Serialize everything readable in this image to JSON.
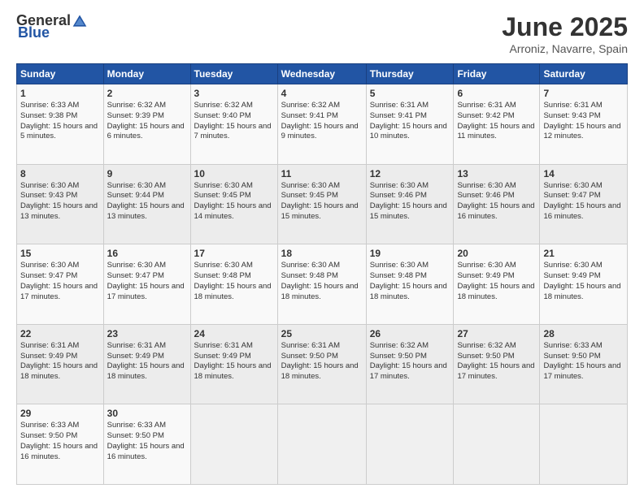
{
  "header": {
    "logo_general": "General",
    "logo_blue": "Blue",
    "month_title": "June 2025",
    "location": "Arroniz, Navarre, Spain"
  },
  "calendar": {
    "days_of_week": [
      "Sunday",
      "Monday",
      "Tuesday",
      "Wednesday",
      "Thursday",
      "Friday",
      "Saturday"
    ],
    "weeks": [
      [
        {
          "day": "1",
          "sunrise": "6:33 AM",
          "sunset": "9:38 PM",
          "daylight": "15 hours and 5 minutes."
        },
        {
          "day": "2",
          "sunrise": "6:32 AM",
          "sunset": "9:39 PM",
          "daylight": "15 hours and 6 minutes."
        },
        {
          "day": "3",
          "sunrise": "6:32 AM",
          "sunset": "9:40 PM",
          "daylight": "15 hours and 7 minutes."
        },
        {
          "day": "4",
          "sunrise": "6:32 AM",
          "sunset": "9:41 PM",
          "daylight": "15 hours and 9 minutes."
        },
        {
          "day": "5",
          "sunrise": "6:31 AM",
          "sunset": "9:41 PM",
          "daylight": "15 hours and 10 minutes."
        },
        {
          "day": "6",
          "sunrise": "6:31 AM",
          "sunset": "9:42 PM",
          "daylight": "15 hours and 11 minutes."
        },
        {
          "day": "7",
          "sunrise": "6:31 AM",
          "sunset": "9:43 PM",
          "daylight": "15 hours and 12 minutes."
        }
      ],
      [
        {
          "day": "8",
          "sunrise": "6:30 AM",
          "sunset": "9:43 PM",
          "daylight": "15 hours and 13 minutes."
        },
        {
          "day": "9",
          "sunrise": "6:30 AM",
          "sunset": "9:44 PM",
          "daylight": "15 hours and 13 minutes."
        },
        {
          "day": "10",
          "sunrise": "6:30 AM",
          "sunset": "9:45 PM",
          "daylight": "15 hours and 14 minutes."
        },
        {
          "day": "11",
          "sunrise": "6:30 AM",
          "sunset": "9:45 PM",
          "daylight": "15 hours and 15 minutes."
        },
        {
          "day": "12",
          "sunrise": "6:30 AM",
          "sunset": "9:46 PM",
          "daylight": "15 hours and 15 minutes."
        },
        {
          "day": "13",
          "sunrise": "6:30 AM",
          "sunset": "9:46 PM",
          "daylight": "15 hours and 16 minutes."
        },
        {
          "day": "14",
          "sunrise": "6:30 AM",
          "sunset": "9:47 PM",
          "daylight": "15 hours and 16 minutes."
        }
      ],
      [
        {
          "day": "15",
          "sunrise": "6:30 AM",
          "sunset": "9:47 PM",
          "daylight": "15 hours and 17 minutes."
        },
        {
          "day": "16",
          "sunrise": "6:30 AM",
          "sunset": "9:47 PM",
          "daylight": "15 hours and 17 minutes."
        },
        {
          "day": "17",
          "sunrise": "6:30 AM",
          "sunset": "9:48 PM",
          "daylight": "15 hours and 18 minutes."
        },
        {
          "day": "18",
          "sunrise": "6:30 AM",
          "sunset": "9:48 PM",
          "daylight": "15 hours and 18 minutes."
        },
        {
          "day": "19",
          "sunrise": "6:30 AM",
          "sunset": "9:48 PM",
          "daylight": "15 hours and 18 minutes."
        },
        {
          "day": "20",
          "sunrise": "6:30 AM",
          "sunset": "9:49 PM",
          "daylight": "15 hours and 18 minutes."
        },
        {
          "day": "21",
          "sunrise": "6:30 AM",
          "sunset": "9:49 PM",
          "daylight": "15 hours and 18 minutes."
        }
      ],
      [
        {
          "day": "22",
          "sunrise": "6:31 AM",
          "sunset": "9:49 PM",
          "daylight": "15 hours and 18 minutes."
        },
        {
          "day": "23",
          "sunrise": "6:31 AM",
          "sunset": "9:49 PM",
          "daylight": "15 hours and 18 minutes."
        },
        {
          "day": "24",
          "sunrise": "6:31 AM",
          "sunset": "9:49 PM",
          "daylight": "15 hours and 18 minutes."
        },
        {
          "day": "25",
          "sunrise": "6:31 AM",
          "sunset": "9:50 PM",
          "daylight": "15 hours and 18 minutes."
        },
        {
          "day": "26",
          "sunrise": "6:32 AM",
          "sunset": "9:50 PM",
          "daylight": "15 hours and 17 minutes."
        },
        {
          "day": "27",
          "sunrise": "6:32 AM",
          "sunset": "9:50 PM",
          "daylight": "15 hours and 17 minutes."
        },
        {
          "day": "28",
          "sunrise": "6:33 AM",
          "sunset": "9:50 PM",
          "daylight": "15 hours and 17 minutes."
        }
      ],
      [
        {
          "day": "29",
          "sunrise": "6:33 AM",
          "sunset": "9:50 PM",
          "daylight": "15 hours and 16 minutes."
        },
        {
          "day": "30",
          "sunrise": "6:33 AM",
          "sunset": "9:50 PM",
          "daylight": "15 hours and 16 minutes."
        },
        null,
        null,
        null,
        null,
        null
      ]
    ]
  }
}
